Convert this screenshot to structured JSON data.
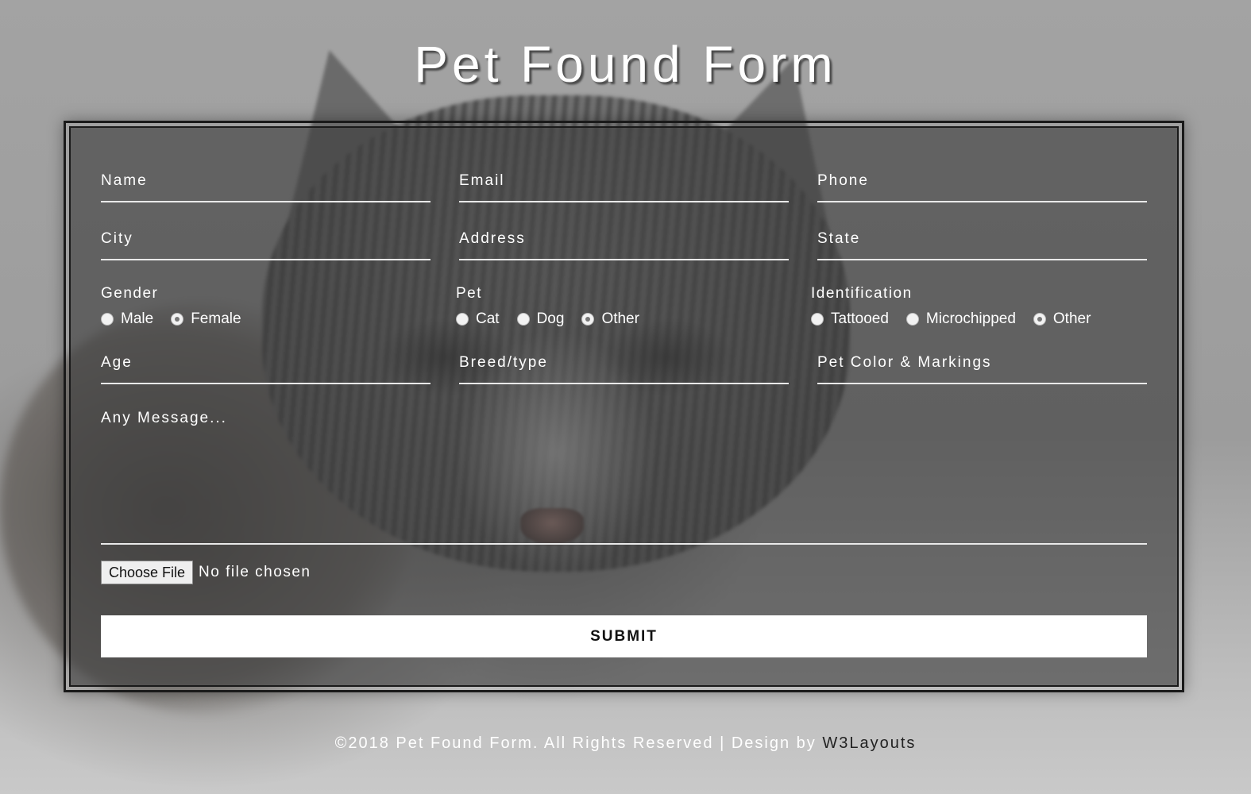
{
  "title": "Pet Found Form",
  "fields": {
    "name": "Name",
    "email": "Email",
    "phone": "Phone",
    "city": "City",
    "address": "Address",
    "state": "State",
    "age": "Age",
    "breed": "Breed/type",
    "color": "Pet Color & Markings",
    "message": "Any Message..."
  },
  "gender": {
    "label": "Gender",
    "options": [
      "Male",
      "Female"
    ],
    "selected": "Female"
  },
  "pet": {
    "label": "Pet",
    "options": [
      "Cat",
      "Dog",
      "Other"
    ],
    "selected": "Other"
  },
  "identification": {
    "label": "Identification",
    "options": [
      "Tattooed",
      "Microchipped",
      "Other"
    ],
    "selected": "Other"
  },
  "file": {
    "button": "Choose File",
    "status": "No file chosen"
  },
  "submit": "SUBMIT",
  "footer": {
    "text": "©2018 Pet Found Form. All Rights Reserved | Design by",
    "link": "W3Layouts"
  },
  "colors": {
    "panel": "#3c3c3c",
    "underline": "#e9e9e9",
    "submit_bg": "#ffffff"
  }
}
